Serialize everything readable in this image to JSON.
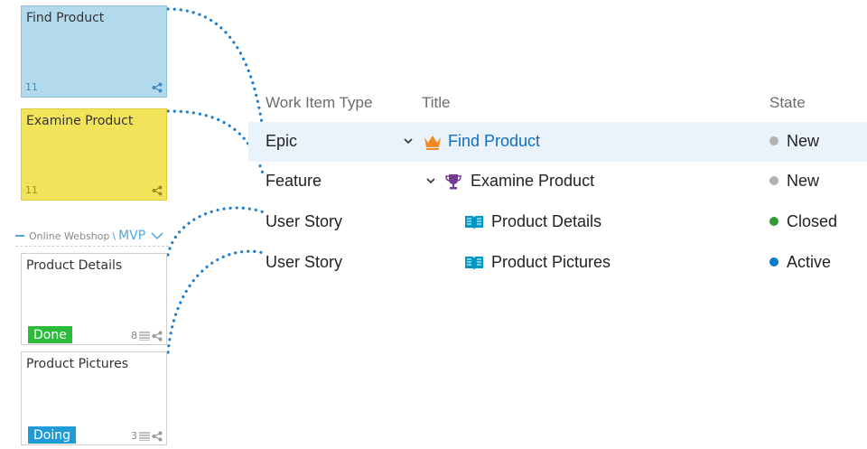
{
  "cards": {
    "find": {
      "title": "Find Product",
      "id": "11",
      "color": "#b3d9ec"
    },
    "examine": {
      "title": "Examine Product",
      "id": "11",
      "color": "#f2e45a"
    },
    "details": {
      "title": "Product Details",
      "status": "Done",
      "count": "8"
    },
    "pictures": {
      "title": "Product Pictures",
      "status": "Doing",
      "count": "3"
    }
  },
  "swimlane": {
    "project": "Online Webshop",
    "separator": "\\",
    "iteration": "MVP"
  },
  "table": {
    "headers": {
      "type": "Work Item Type",
      "title": "Title",
      "state": "State"
    },
    "rows": [
      {
        "type": "Epic",
        "title": "Find Product",
        "state": "New",
        "icon": "crown-icon",
        "state_color": "#b2b2b2"
      },
      {
        "type": "Feature",
        "title": "Examine Product",
        "state": "New",
        "icon": "trophy-icon",
        "state_color": "#b2b2b2"
      },
      {
        "type": "User Story",
        "title": "Product Details",
        "state": "Closed",
        "icon": "book-icon",
        "state_color": "#339933"
      },
      {
        "type": "User Story",
        "title": "Product Pictures",
        "state": "Active",
        "icon": "book-icon",
        "state_color": "#007acc"
      }
    ]
  },
  "colors": {
    "accent": "#106ebe",
    "connector": "#1e7fd0",
    "selected_row": "#eaf3fc"
  }
}
